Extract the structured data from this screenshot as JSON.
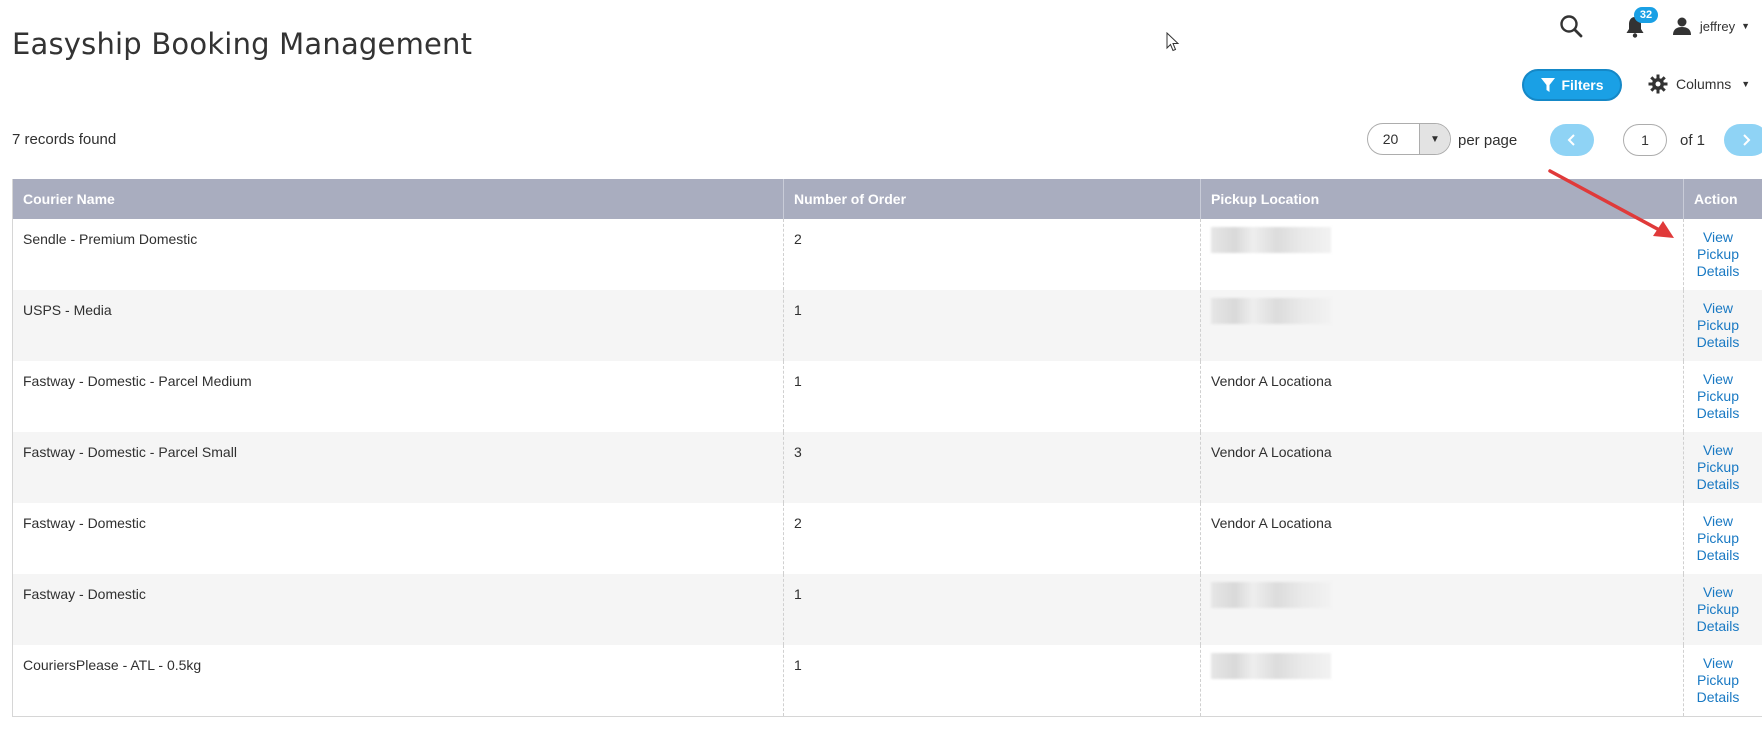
{
  "header": {
    "title": "Easyship Booking Management",
    "notification_count": "32",
    "username": "jeffrey"
  },
  "toolbar": {
    "filters_label": "Filters",
    "columns_label": "Columns"
  },
  "pagination": {
    "records_found": "7 records found",
    "per_page_value": "20",
    "per_page_label": "per page",
    "current_page": "1",
    "of_pages": "of 1"
  },
  "table": {
    "columns": [
      "Courier Name",
      "Number of Order",
      "Pickup Location",
      "Action"
    ],
    "rows": [
      {
        "courier": "Sendle - Premium Domestic",
        "orders": "2",
        "location": "",
        "location_redacted": true
      },
      {
        "courier": "USPS - Media",
        "orders": "1",
        "location": "",
        "location_redacted": true
      },
      {
        "courier": "Fastway - Domestic - Parcel Medium",
        "orders": "1",
        "location": "Vendor A Locationa",
        "location_redacted": false
      },
      {
        "courier": "Fastway - Domestic - Parcel Small",
        "orders": "3",
        "location": "Vendor A Locationa",
        "location_redacted": false
      },
      {
        "courier": "Fastway - Domestic",
        "orders": "2",
        "location": "Vendor A Locationa",
        "location_redacted": false
      },
      {
        "courier": "Fastway - Domestic",
        "orders": "1",
        "location": "",
        "location_redacted": true
      },
      {
        "courier": "CouriersPlease - ATL - 0.5kg",
        "orders": "1",
        "location": "",
        "location_redacted": true
      }
    ],
    "action_label": [
      "View",
      "Pickup",
      "Details"
    ]
  },
  "icons": {
    "search": "search-icon",
    "bell": "bell-icon",
    "user": "user-icon",
    "filter": "filter-icon",
    "gear": "gear-icon"
  },
  "colors": {
    "accent": "#1aa0e5",
    "header_bg": "#a9adbf",
    "link": "#1979c3",
    "annotation_arrow": "#e03a3a"
  }
}
